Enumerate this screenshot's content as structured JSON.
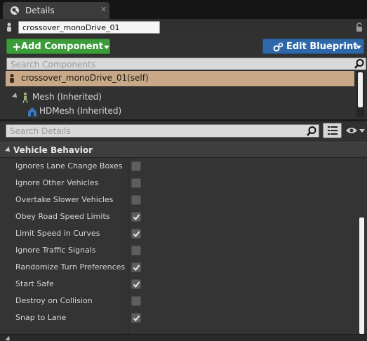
{
  "tab": {
    "title": "Details",
    "close": "✕"
  },
  "actor": {
    "name": "crossover_monoDrive_01"
  },
  "toolbar": {
    "add_component": "Add Component",
    "edit_blueprint": "Edit Blueprint"
  },
  "component_search": {
    "placeholder": "Search Components"
  },
  "components": {
    "root": "crossover_monoDrive_01(self)",
    "children": [
      {
        "label": "Mesh (Inherited)"
      },
      {
        "label": "HDMesh (Inherited)"
      }
    ]
  },
  "details_search": {
    "placeholder": "Search Details"
  },
  "category": {
    "label": "Vehicle Behavior"
  },
  "properties": [
    {
      "label": "Ignores Lane Change Boxes",
      "checked": false
    },
    {
      "label": "Ignore Other Vehicles",
      "checked": false
    },
    {
      "label": "Overtake Slower Vehicles",
      "checked": false
    },
    {
      "label": "Obey Road Speed Limits",
      "checked": true
    },
    {
      "label": "Limit Speed in Curves",
      "checked": true
    },
    {
      "label": "Ignore Traffic Signals",
      "checked": false
    },
    {
      "label": "Randomize Turn Preferences",
      "checked": true
    },
    {
      "label": "Start Safe",
      "checked": true
    },
    {
      "label": "Destroy on Collision",
      "checked": false
    },
    {
      "label": "Snap to Lane",
      "checked": true
    }
  ],
  "colors": {
    "add_button": "#3d9c3a",
    "edit_button": "#2f68a8",
    "selected_component": "#c8a886",
    "panel_bg": "#313131"
  }
}
